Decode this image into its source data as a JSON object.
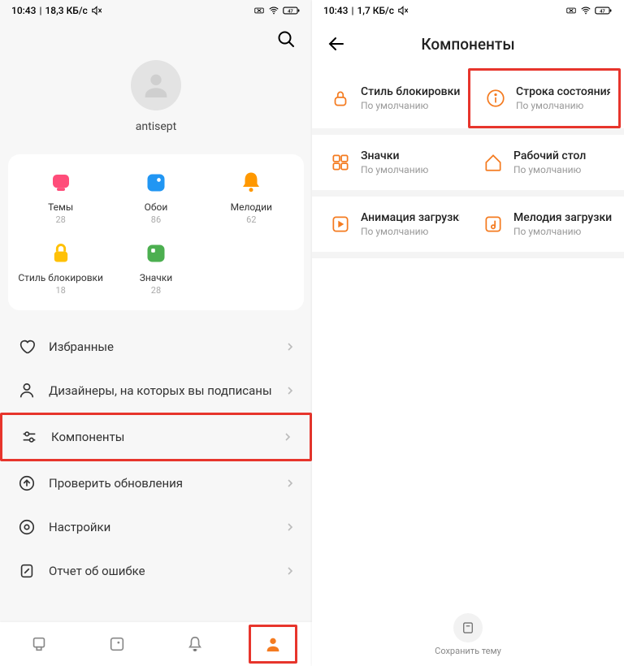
{
  "left": {
    "status": {
      "time": "10:43",
      "net": "18,3 КБ/с"
    },
    "username": "antisept",
    "categories": [
      {
        "label": "Темы",
        "count": "28"
      },
      {
        "label": "Обои",
        "count": "86"
      },
      {
        "label": "Мелодии",
        "count": "62"
      },
      {
        "label": "Стиль блокировки",
        "count": "18"
      },
      {
        "label": "Значки",
        "count": "28"
      }
    ],
    "menu": {
      "favorites": "Избранные",
      "designers": "Дизайнеры, на которых вы подписаны",
      "components": "Компоненты",
      "updates": "Проверить обновления",
      "settings": "Настройки",
      "report": "Отчет об ошибке"
    }
  },
  "right": {
    "status": {
      "time": "10:43",
      "net": "1,7 КБ/с"
    },
    "title": "Компоненты",
    "default": "По умолчанию",
    "items": {
      "lockstyle": "Стиль блокировки",
      "statusbar": "Строка состояния",
      "icons": "Значки",
      "desktop": "Рабочий стол",
      "bootanim": "Анимация загрузки",
      "bootsound": "Мелодия загрузки"
    },
    "save": "Сохранить тему"
  }
}
